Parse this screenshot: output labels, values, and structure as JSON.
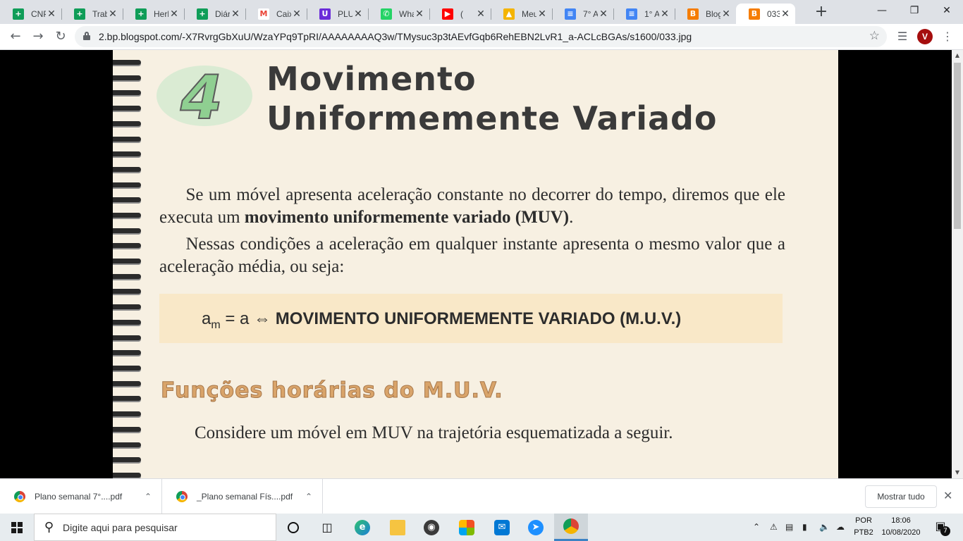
{
  "browser": {
    "tabs": [
      {
        "label": "CNP",
        "favicon": "sheets-icon",
        "color": "#0f9d58",
        "glyph": "+"
      },
      {
        "label": "Trab",
        "favicon": "sheets-icon",
        "color": "#0f9d58",
        "glyph": "+"
      },
      {
        "label": "Herb",
        "favicon": "sheets-icon",
        "color": "#0f9d58",
        "glyph": "+"
      },
      {
        "label": "Diár",
        "favicon": "sheets-icon",
        "color": "#0f9d58",
        "glyph": "+"
      },
      {
        "label": "Caix",
        "favicon": "gmail-icon",
        "color": "#ffffff",
        "glyph": "M"
      },
      {
        "label": "PLU",
        "favicon": "plurall-icon",
        "color": "#6a2bd9",
        "glyph": "U"
      },
      {
        "label": "Wha",
        "favicon": "whatsapp-icon",
        "color": "#25d366",
        "glyph": "✆"
      },
      {
        "label": "(",
        "favicon": "youtube-icon",
        "color": "#ff0000",
        "glyph": "▶"
      },
      {
        "label": "Meu",
        "favicon": "drive-icon",
        "color": "#f4b400",
        "glyph": "▲"
      },
      {
        "label": "7° A",
        "favicon": "docs-icon",
        "color": "#4285f4",
        "glyph": "≡"
      },
      {
        "label": "1° A",
        "favicon": "docs-icon",
        "color": "#4285f4",
        "glyph": "≡"
      },
      {
        "label": "Blog",
        "favicon": "blogger-icon",
        "color": "#f57d00",
        "glyph": "B"
      },
      {
        "label": "033.",
        "favicon": "blogger-icon",
        "color": "#f57d00",
        "glyph": "B",
        "active": true
      }
    ],
    "url": "2.bp.blogspot.com/-X7RvrgGbXuU/WzaYPq9TpRI/AAAAAAAAQ3w/TMysuc3p3tAEvfGqb6RehEBN2LvR1_a-ACLcBGAs/s1600/033.jpg",
    "avatar_letter": "V"
  },
  "page": {
    "chapter_number": "4",
    "title_line1": "Movimento",
    "title_line2": "Uniformemente Variado",
    "para1_a": "Se um móvel apresenta aceleração constante no decorrer do tempo, diremos que ele executa um ",
    "para1_bold": "movimento uniformemente variado (MUV)",
    "para1_end": ".",
    "para2": "Nessas condições a aceleração em qualquer instante apresenta o mesmo valor que a aceleração média, ou seja:",
    "formula_a": "a",
    "formula_sub": "m",
    "formula_eq": " = a ⇔ ",
    "formula_caps": "MOVIMENTO UNIFORMEMENTE VARIADO",
    "formula_end": " (M.U.V.)",
    "section_title": "Funções horárias do M.U.V.",
    "para3": "Considere um móvel em MUV na trajetória esquematizada a seguir."
  },
  "downloads": {
    "items": [
      {
        "name": "Plano semanal 7°....pdf"
      },
      {
        "name": "_Plano semanal Fís....pdf"
      }
    ],
    "show_all": "Mostrar tudo"
  },
  "taskbar": {
    "search_placeholder": "Digite aqui para pesquisar",
    "lang_line1": "POR",
    "lang_line2": "PTB2",
    "time": "18:06",
    "date": "10/08/2020",
    "notifications": "7"
  }
}
